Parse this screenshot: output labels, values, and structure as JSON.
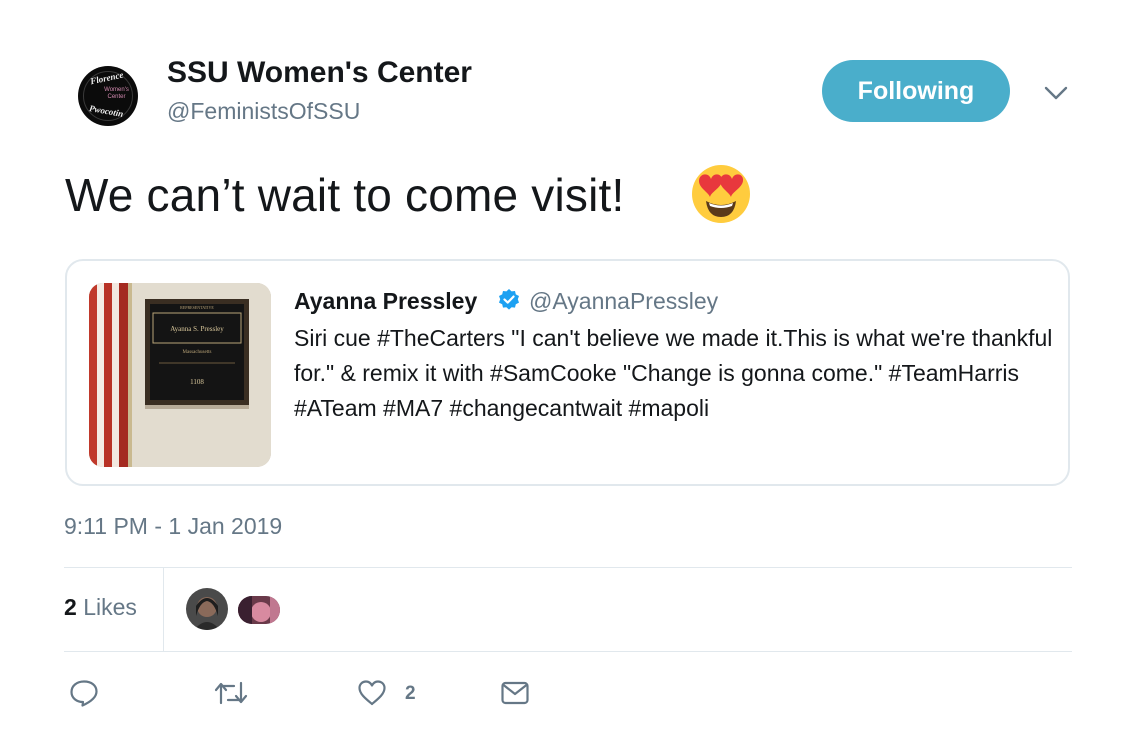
{
  "author": {
    "name": "SSU Women's Center",
    "handle": "@FeministsOfSSU",
    "avatar_text": [
      "Florence",
      "Women's Center",
      "Pwocotin"
    ]
  },
  "follow_button": {
    "label": "Following",
    "color": "#4aaecb"
  },
  "tweet": {
    "text": "We can’t wait to come visit!",
    "emoji": "smiling-face-with-heart-eyes"
  },
  "quoted_tweet": {
    "name": "Ayanna Pressley",
    "verified": true,
    "handle": "@AyannaPressley",
    "text": "Siri cue #TheCarters \"I can't believe we made it.This is what we're thankful for.\" & remix it with #SamCooke \"Change is gonna come.\" #TeamHarris #ATeam #MA7 #changecantwait #mapoli",
    "image_plaque": {
      "name": "Ayanna S. Pressley",
      "state": "Massachusetts",
      "room": "1108"
    }
  },
  "timestamp": "9:11 PM - 1 Jan 2019",
  "likes": {
    "count": "2",
    "label": "Likes"
  },
  "actions": {
    "like_count": "2"
  },
  "colors": {
    "text": "#14171a",
    "secondary": "#657786",
    "border": "#e1e8ed",
    "verified": "#1da1f2"
  }
}
